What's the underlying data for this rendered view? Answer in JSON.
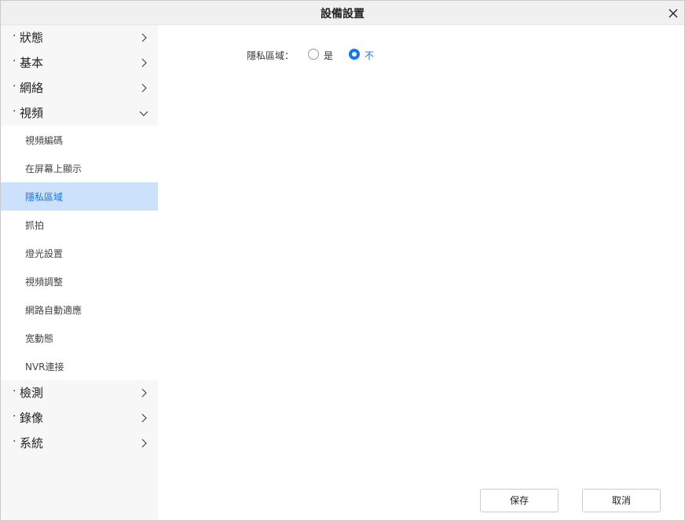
{
  "dialog": {
    "title": "設備設置"
  },
  "sidebar": {
    "groups_top": [
      {
        "dot": "·",
        "label": "狀態",
        "expanded": false
      },
      {
        "dot": "·",
        "label": "基本",
        "expanded": false
      },
      {
        "dot": "·",
        "label": "網絡",
        "expanded": false
      },
      {
        "dot": "·",
        "label": "視頻",
        "expanded": true
      }
    ],
    "video_items": [
      {
        "label": "視頻編碼"
      },
      {
        "label": "在屏幕上顯示"
      },
      {
        "label": "隱私區域",
        "active": true
      },
      {
        "label": "抓拍"
      },
      {
        "label": "燈光設置"
      },
      {
        "label": "視頻調整"
      },
      {
        "label": "網路自動適應"
      },
      {
        "label": "宽動態"
      },
      {
        "label": "NVR連接"
      }
    ],
    "groups_bottom": [
      {
        "dot": "·",
        "label": "檢測",
        "expanded": false
      },
      {
        "dot": "·",
        "label": "錄像",
        "expanded": false
      },
      {
        "dot": "·",
        "label": "系統",
        "expanded": false
      }
    ]
  },
  "main": {
    "privacy_label": "隱私區域：",
    "options": [
      {
        "label": "是",
        "checked": false
      },
      {
        "label": "不",
        "checked": true
      }
    ]
  },
  "footer": {
    "save_label": "保存",
    "cancel_label": "取消"
  },
  "colors": {
    "accent": "#1677e8",
    "active_bg": "#cce1fb",
    "sidebar_bg": "#f7f7f7"
  }
}
